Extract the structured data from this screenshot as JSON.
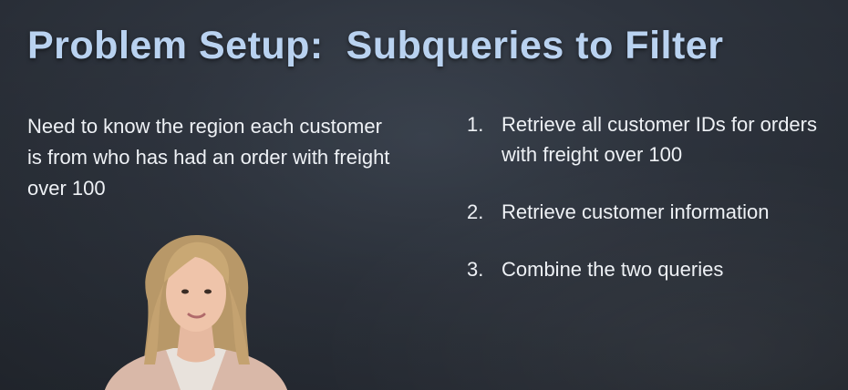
{
  "slide": {
    "title": "Problem Setup:  Subqueries to Filter",
    "description": "Need to know the region each customer is from who has had an order with freight over 100",
    "steps": [
      {
        "number": "1.",
        "text": "Retrieve all customer IDs for orders with freight over 100"
      },
      {
        "number": "2.",
        "text": "Retrieve customer information"
      },
      {
        "number": "3.",
        "text": "Combine the two queries"
      }
    ]
  },
  "colors": {
    "title": "#b9d2f0",
    "text": "#eef1f5",
    "background": "#2f353f"
  }
}
